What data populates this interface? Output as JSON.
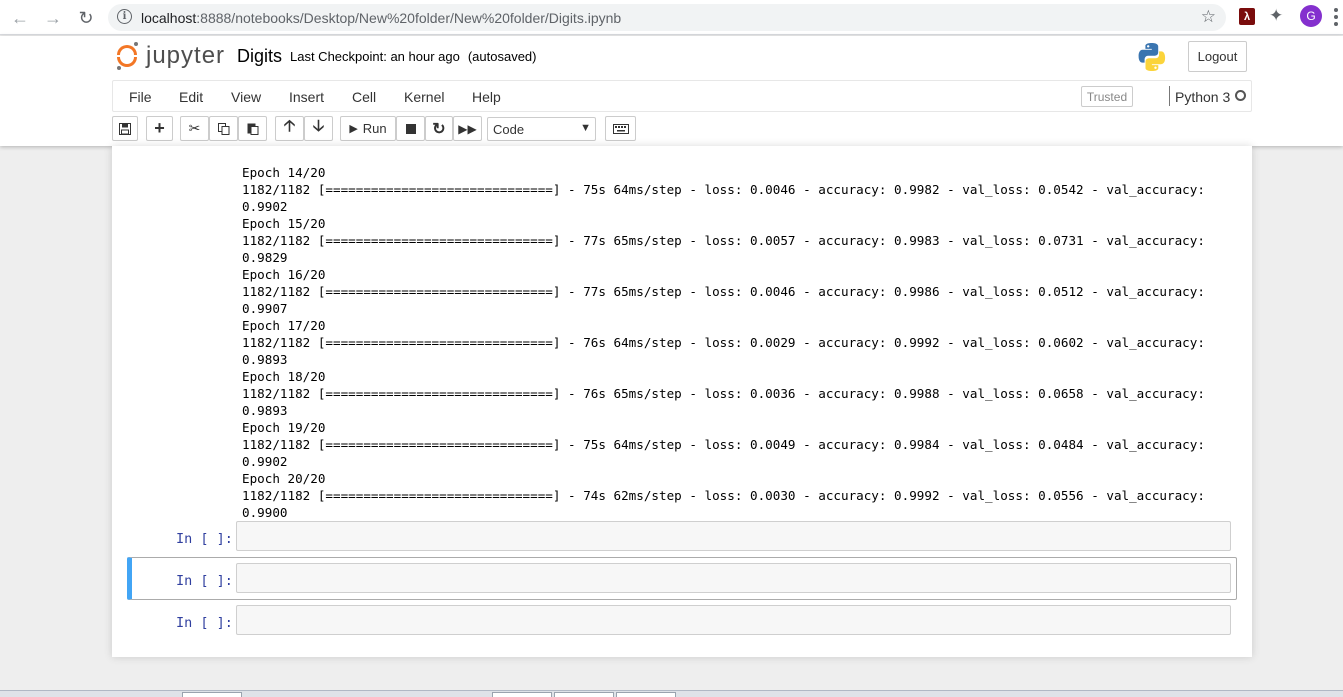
{
  "browser": {
    "url_host": "localhost",
    "url_rest": ":8888/notebooks/Desktop/New%20folder/New%20folder/Digits.ipynb",
    "profile_initial": "G"
  },
  "header": {
    "logo_text": "jupyter",
    "notebook_name": "Digits",
    "checkpoint": "Last Checkpoint: an hour ago",
    "autosave": "(autosaved)",
    "logout_label": "Logout"
  },
  "menubar": {
    "items": [
      "File",
      "Edit",
      "View",
      "Insert",
      "Cell",
      "Kernel",
      "Help"
    ],
    "trusted_label": "Trusted",
    "kernel_name": "Python 3"
  },
  "toolbar": {
    "run_label": "Run",
    "cell_type": "Code"
  },
  "output_lines": [
    "Epoch 14/20",
    "1182/1182 [==============================] - 75s 64ms/step - loss: 0.0046 - accuracy: 0.9982 - val_loss: 0.0542 - val_accuracy:",
    "0.9902",
    "Epoch 15/20",
    "1182/1182 [==============================] - 77s 65ms/step - loss: 0.0057 - accuracy: 0.9983 - val_loss: 0.0731 - val_accuracy:",
    "0.9829",
    "Epoch 16/20",
    "1182/1182 [==============================] - 77s 65ms/step - loss: 0.0046 - accuracy: 0.9986 - val_loss: 0.0512 - val_accuracy:",
    "0.9907",
    "Epoch 17/20",
    "1182/1182 [==============================] - 76s 64ms/step - loss: 0.0029 - accuracy: 0.9992 - val_loss: 0.0602 - val_accuracy:",
    "0.9893",
    "Epoch 18/20",
    "1182/1182 [==============================] - 76s 65ms/step - loss: 0.0036 - accuracy: 0.9988 - val_loss: 0.0658 - val_accuracy:",
    "0.9893",
    "Epoch 19/20",
    "1182/1182 [==============================] - 75s 64ms/step - loss: 0.0049 - accuracy: 0.9984 - val_loss: 0.0484 - val_accuracy:",
    "0.9902",
    "Epoch 20/20",
    "1182/1182 [==============================] - 74s 62ms/step - loss: 0.0030 - accuracy: 0.9992 - val_loss: 0.0556 - val_accuracy:",
    "0.9900"
  ],
  "cells": [
    {
      "prompt": "In [ ]:",
      "selected": false
    },
    {
      "prompt": "In [ ]:",
      "selected": true
    },
    {
      "prompt": "In [ ]:",
      "selected": false
    }
  ],
  "colors": {
    "accent": "#42a5f5",
    "prompt": "#303f9f",
    "jupyter_orange": "#f37726"
  }
}
